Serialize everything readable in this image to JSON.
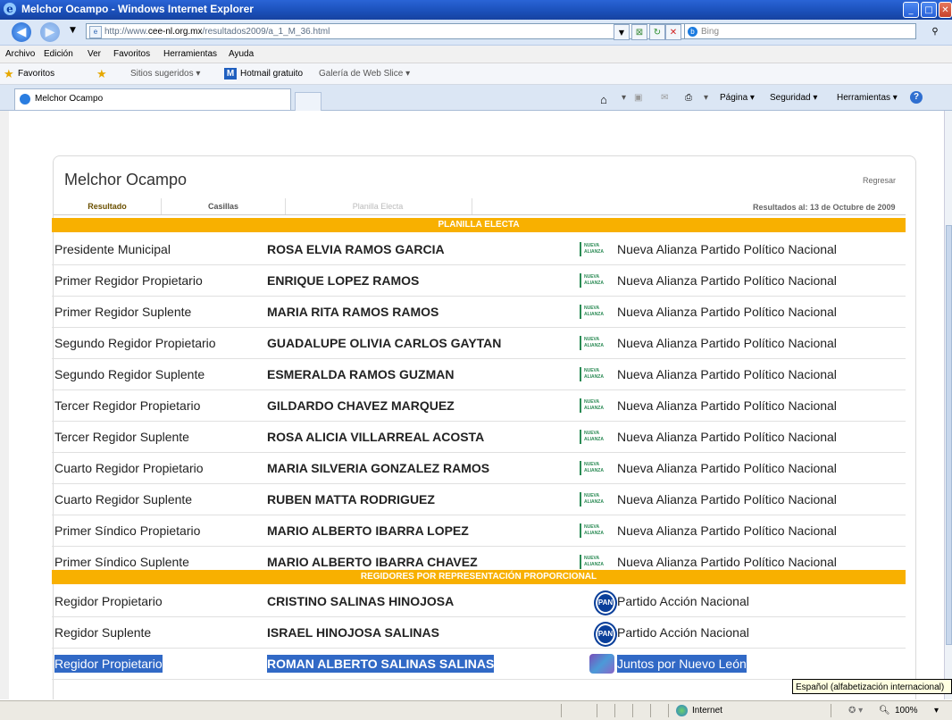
{
  "window": {
    "title": "Melchor Ocampo - Windows Internet Explorer"
  },
  "address_bar": {
    "url_prefix": "http://www.",
    "url_domain": "cee-nl.org.mx",
    "url_path": "/resultados2009/a_1_M_36.html",
    "search_placeholder": "Bing"
  },
  "menu": [
    "Archivo",
    "Edición",
    "Ver",
    "Favoritos",
    "Herramientas",
    "Ayuda"
  ],
  "favorites_bar": {
    "favoritos": "Favoritos",
    "sitios": "Sitios sugeridos ▾",
    "hotmail": "Hotmail gratuito",
    "galeria": "Galería de Web Slice ▾"
  },
  "tab": {
    "title": "Melchor Ocampo"
  },
  "command_bar": {
    "pagina": "Página ▾",
    "seguridad": "Seguridad ▾",
    "herramientas": "Herramientas ▾"
  },
  "page": {
    "municipio": "Melchor Ocampo",
    "regresar": "Regresar",
    "tabs": [
      "Resultado",
      "Casillas",
      "Planilla Electa"
    ],
    "resultados_al": "Resultados al: 13 de Octubre de 2009",
    "section1": "PLANILLA ELECTA",
    "section2": "REGIDORES POR REPRESENTACIÓN PROPORCIONAL",
    "rows1": [
      {
        "pos": "Presidente Municipal",
        "name": "ROSA ELVIA RAMOS GARCIA",
        "party": "Nueva Alianza Partido Político Nacional"
      },
      {
        "pos": "Primer Regidor Propietario",
        "name": "ENRIQUE LOPEZ RAMOS",
        "party": "Nueva Alianza Partido Político Nacional"
      },
      {
        "pos": "Primer Regidor Suplente",
        "name": "MARIA RITA RAMOS RAMOS",
        "party": "Nueva Alianza Partido Político Nacional"
      },
      {
        "pos": "Segundo Regidor Propietario",
        "name": "GUADALUPE OLIVIA CARLOS GAYTAN",
        "party": "Nueva Alianza Partido Político Nacional"
      },
      {
        "pos": "Segundo Regidor Suplente",
        "name": "ESMERALDA RAMOS GUZMAN",
        "party": "Nueva Alianza Partido Político Nacional"
      },
      {
        "pos": "Tercer Regidor Propietario",
        "name": "GILDARDO CHAVEZ MARQUEZ",
        "party": "Nueva Alianza Partido Político Nacional"
      },
      {
        "pos": "Tercer Regidor Suplente",
        "name": "ROSA ALICIA VILLARREAL ACOSTA",
        "party": "Nueva Alianza Partido Político Nacional"
      },
      {
        "pos": "Cuarto Regidor Propietario",
        "name": "MARIA SILVERIA GONZALEZ RAMOS",
        "party": "Nueva Alianza Partido Político Nacional"
      },
      {
        "pos": "Cuarto Regidor Suplente",
        "name": "RUBEN MATTA RODRIGUEZ",
        "party": "Nueva Alianza Partido Político Nacional"
      },
      {
        "pos": "Primer Síndico Propietario",
        "name": "MARIO ALBERTO IBARRA LOPEZ",
        "party": "Nueva Alianza Partido Político Nacional"
      },
      {
        "pos": "Primer Síndico Suplente",
        "name": "MARIO ALBERTO IBARRA CHAVEZ",
        "party": "Nueva Alianza Partido Político Nacional"
      }
    ],
    "rows2": [
      {
        "pos": "Regidor Propietario",
        "name": "CRISTINO SALINAS HINOJOSA",
        "party": "Partido Acción Nacional"
      },
      {
        "pos": "Regidor Suplente",
        "name": "ISRAEL HINOJOSA SALINAS",
        "party": "Partido Acción Nacional"
      },
      {
        "pos": "Regidor Propietario",
        "name": "ROMAN ALBERTO SALINAS SALINAS",
        "party": "Juntos por Nuevo León"
      }
    ],
    "na_logo_text": "NUEVA ALIANZA",
    "pan_logo_text": "PAN"
  },
  "tooltip": "Español (alfabetización internacional)",
  "status": {
    "zone": "Internet",
    "zoom": "100%"
  }
}
